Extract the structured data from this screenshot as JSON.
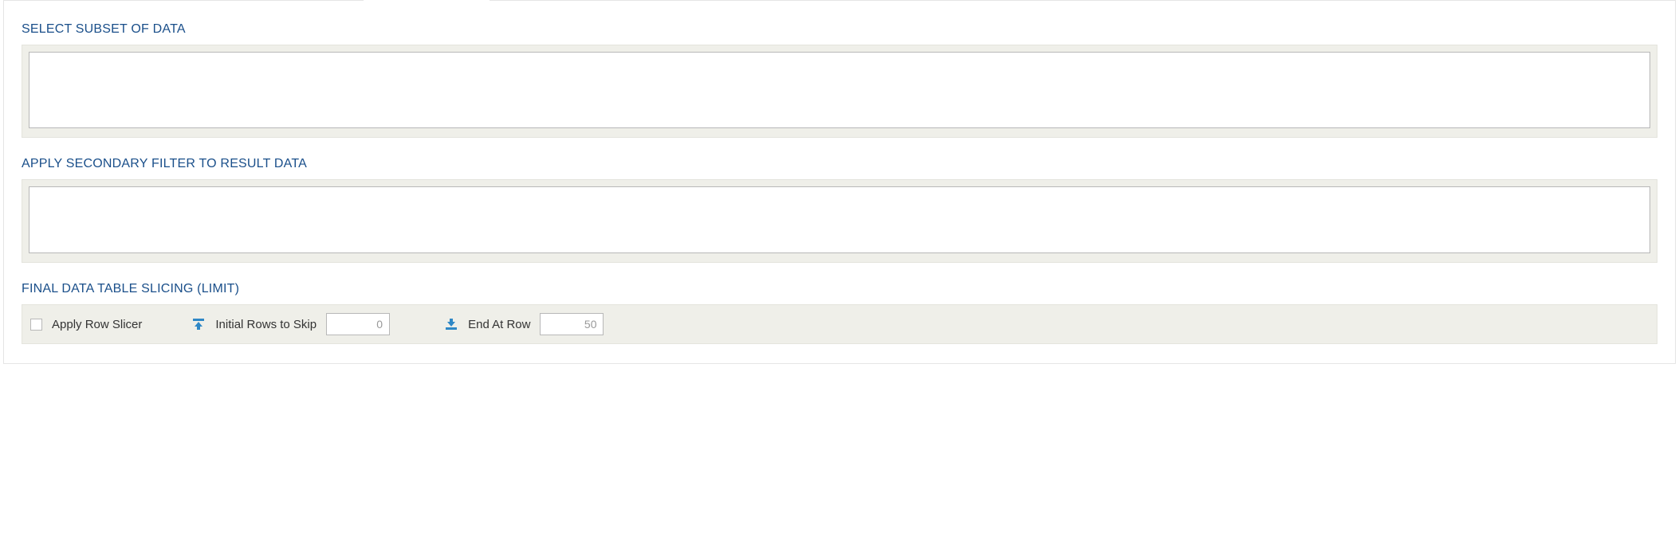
{
  "sections": {
    "subset": {
      "heading": "SELECT SUBSET OF DATA",
      "value": ""
    },
    "secondary": {
      "heading": "APPLY SECONDARY FILTER TO RESULT DATA",
      "value": ""
    },
    "slicing": {
      "heading": "FINAL DATA TABLE SLICING (LIMIT)",
      "apply_label": "Apply Row Slicer",
      "apply_checked": false,
      "initial_label": "Initial Rows to Skip",
      "initial_value": "0",
      "end_label": "End At Row",
      "end_value": "50"
    }
  }
}
